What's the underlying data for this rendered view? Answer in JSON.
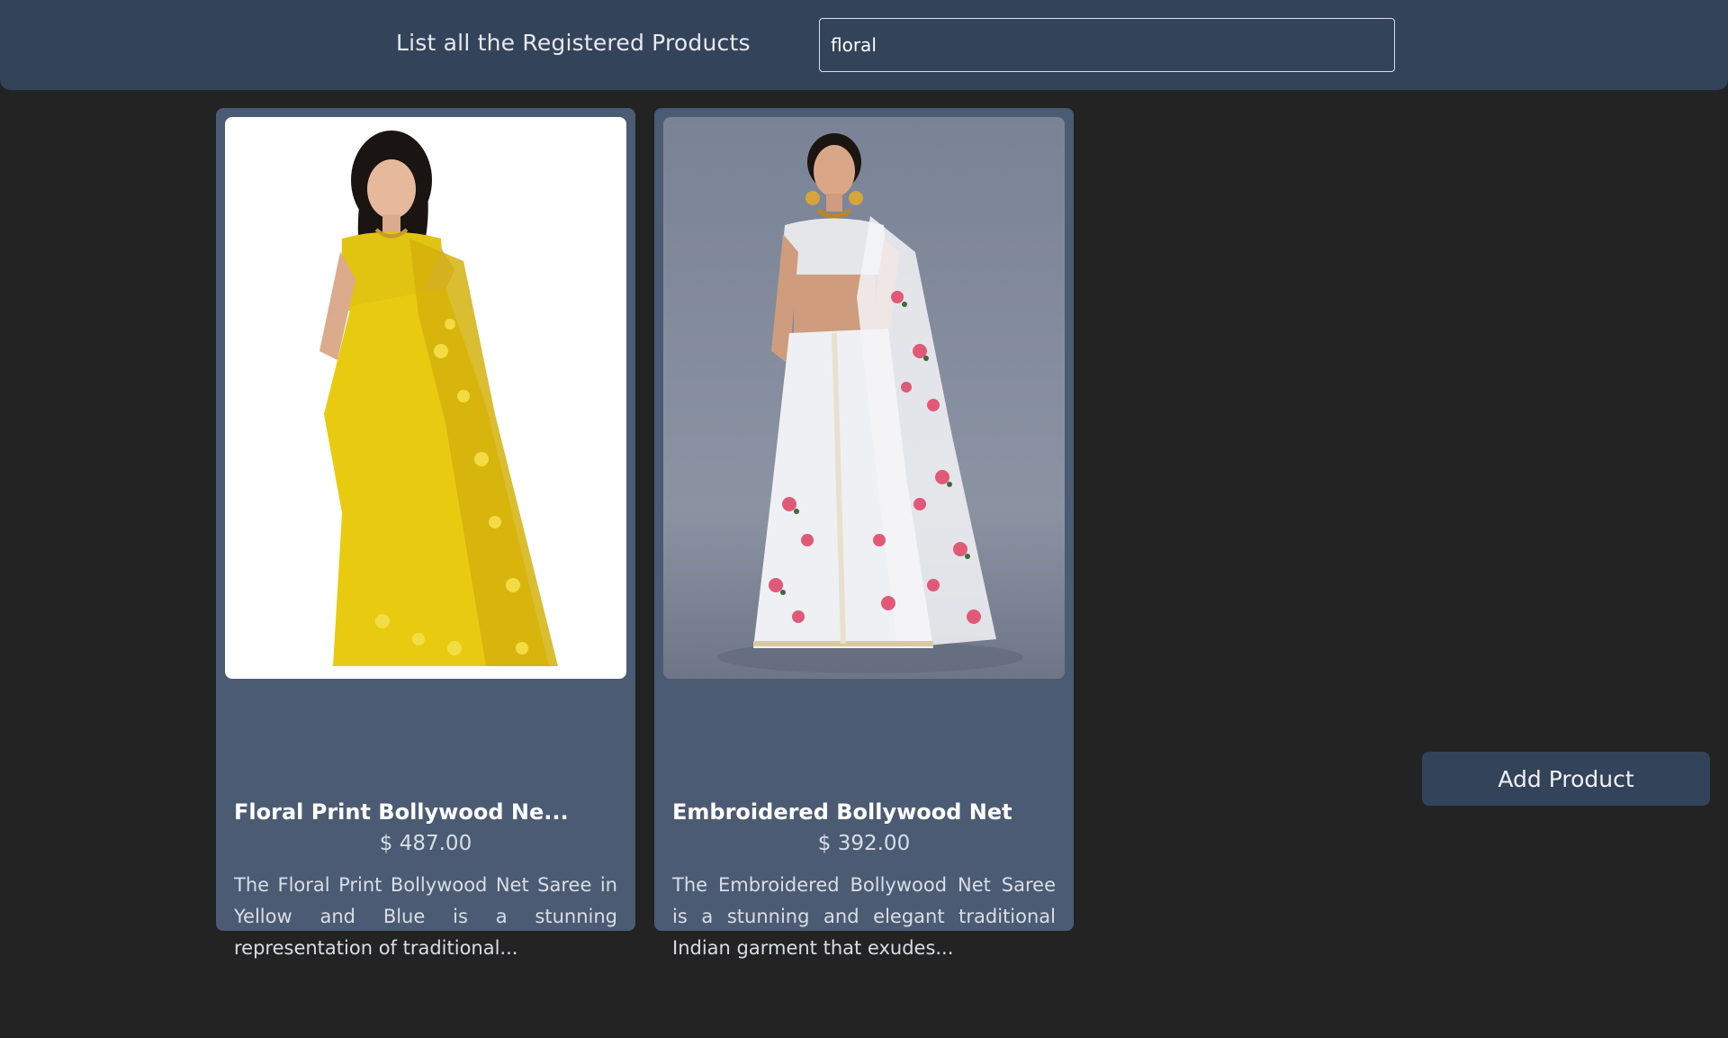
{
  "header": {
    "title": "List all the Registered Products",
    "search_value": "floral",
    "bg_color": "#334359"
  },
  "products": [
    {
      "name": "Floral Print Bollywood Ne...",
      "price": "$ 487.00",
      "description": "The Floral Print Bollywood Net Saree in Yellow and Blue is a stunning representation of traditional...",
      "image_icon": "yellow-saree-photo"
    },
    {
      "name": "Embroidered Bollywood Net",
      "price": "$ 392.00",
      "description": "The Embroidered Bollywood Net Saree is a stunning and elegant traditional Indian garment that exudes...",
      "image_icon": "white-floral-saree-photo"
    }
  ],
  "actions": {
    "add_product_label": "Add Product"
  },
  "colors": {
    "page_bg": "#232323",
    "card_bg": "#4b5b73",
    "accent": "#334359"
  }
}
